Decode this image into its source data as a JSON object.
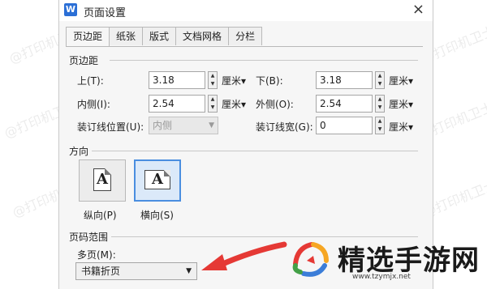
{
  "dialog": {
    "title": "页面设置",
    "app_icon": "W",
    "close_glyph": "×"
  },
  "tabs": [
    "页边距",
    "纸张",
    "版式",
    "文档网格",
    "分栏"
  ],
  "margins": {
    "section_title": "页边距",
    "top_label": "上(T):",
    "top_value": "3.18",
    "bottom_label": "下(B):",
    "bottom_value": "3.18",
    "inside_label": "内侧(I):",
    "inside_value": "2.54",
    "outside_label": "外侧(O):",
    "outside_value": "2.54",
    "gutter_pos_label": "装订线位置(U):",
    "gutter_pos_value": "内侧",
    "gutter_width_label": "装订线宽(G):",
    "gutter_width_value": "0",
    "unit": "厘米▾"
  },
  "orientation": {
    "section_title": "方向",
    "portrait_label": "纵向(P)",
    "landscape_label": "横向(S)",
    "page_glyph": "A",
    "selected": "landscape"
  },
  "pages": {
    "section_title": "页码范围",
    "multiple_label": "多页(M):",
    "multiple_value": "书籍折页"
  },
  "watermark": "@打印机卫士",
  "brand": {
    "name": "精选手游网",
    "url": "www.tzymjx.net"
  },
  "colors": {
    "accent": "#4a8ee0",
    "annotation_arrow": "#e53935"
  }
}
